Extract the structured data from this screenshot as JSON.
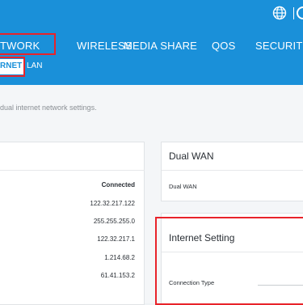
{
  "top_icons": {
    "globe": "globe-icon",
    "user": "user-icon"
  },
  "nav": {
    "items": [
      {
        "label": "TWORK",
        "active": true
      },
      {
        "label": "WIRELESS"
      },
      {
        "label": "MEDIA SHARE"
      },
      {
        "label": "QOS"
      },
      {
        "label": "SECURITY"
      }
    ]
  },
  "subnav": {
    "items": [
      {
        "label": "RNET",
        "active": true
      },
      {
        "label": "LAN"
      }
    ]
  },
  "page": {
    "description": "dual internet network settings."
  },
  "status_card": {
    "values": [
      "Connected",
      "122.32.217.122",
      "255.255.255.0",
      "122.32.217.1",
      "1.214.68.2",
      "61.41.153.2"
    ]
  },
  "dual_wan": {
    "title": "Dual WAN",
    "field_label": "Dual WAN"
  },
  "internet_setting": {
    "title": "Internet Setting",
    "connection_type_label": "Connection Type",
    "connection_type_value": ""
  },
  "colors": {
    "header": "#1a90d9",
    "highlight": "#e8232a",
    "background": "#f4f6f8"
  }
}
